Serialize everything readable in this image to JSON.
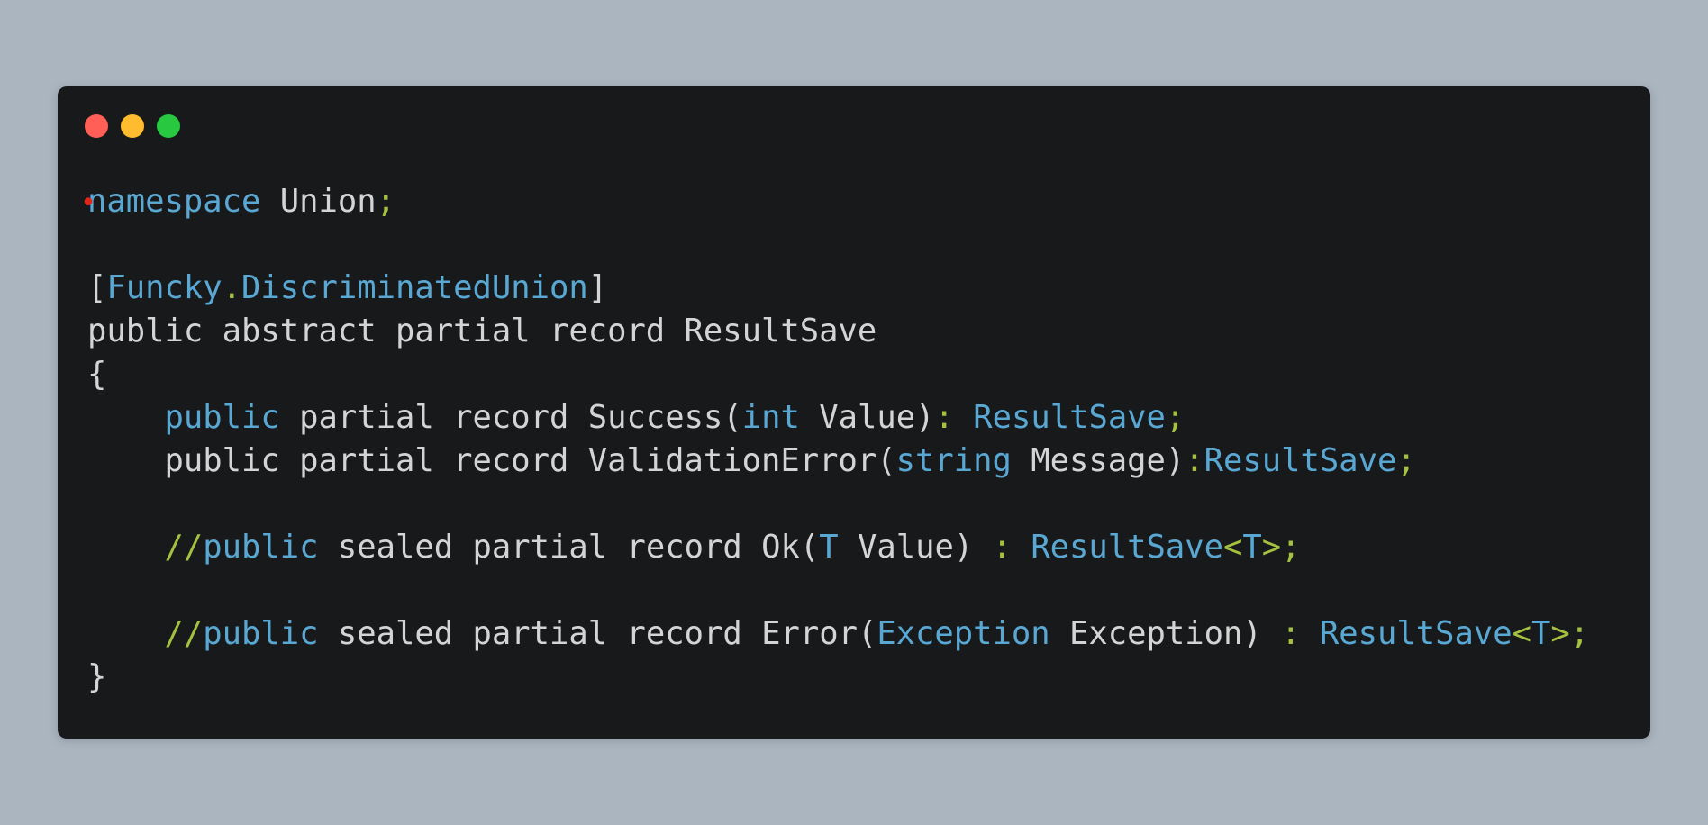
{
  "window": {
    "dots": [
      {
        "name": "close-dot",
        "color": "#ff5f57"
      },
      {
        "name": "minimize-dot",
        "color": "#febc2e"
      },
      {
        "name": "maximize-dot",
        "color": "#28c840"
      }
    ]
  },
  "colors": {
    "background": "#abb5c0",
    "editor": "#18191b",
    "text": "#d4d4d4",
    "keyword": "#59a7d3",
    "punctuation": "#a4c13f",
    "marker": "#e0261b"
  },
  "code_lines": [
    {
      "tokens": [
        {
          "t": "•",
          "c": "marker"
        },
        {
          "t": "namespace",
          "c": "keyword"
        },
        {
          "t": " Union",
          "c": "text"
        },
        {
          "t": ";",
          "c": "punctuation"
        }
      ]
    },
    {
      "tokens": []
    },
    {
      "tokens": [
        {
          "t": "[",
          "c": "text"
        },
        {
          "t": "Funcky",
          "c": "keyword"
        },
        {
          "t": ".",
          "c": "punctuation"
        },
        {
          "t": "DiscriminatedUnion",
          "c": "keyword"
        },
        {
          "t": "]",
          "c": "text"
        }
      ]
    },
    {
      "tokens": [
        {
          "t": "public abstract partial record ResultSave",
          "c": "text"
        }
      ]
    },
    {
      "tokens": [
        {
          "t": "{",
          "c": "text"
        }
      ]
    },
    {
      "tokens": [
        {
          "t": "    ",
          "c": "text"
        },
        {
          "t": "public",
          "c": "keyword"
        },
        {
          "t": " partial record Success(",
          "c": "text"
        },
        {
          "t": "int",
          "c": "keyword"
        },
        {
          "t": " Value)",
          "c": "text"
        },
        {
          "t": ": ",
          "c": "punctuation"
        },
        {
          "t": "ResultSave",
          "c": "keyword"
        },
        {
          "t": ";",
          "c": "punctuation"
        }
      ]
    },
    {
      "tokens": [
        {
          "t": "    public partial record ValidationError(",
          "c": "text"
        },
        {
          "t": "string",
          "c": "keyword"
        },
        {
          "t": " Message)",
          "c": "text"
        },
        {
          "t": ":",
          "c": "punctuation"
        },
        {
          "t": "ResultSave",
          "c": "keyword"
        },
        {
          "t": ";",
          "c": "punctuation"
        }
      ]
    },
    {
      "tokens": []
    },
    {
      "tokens": [
        {
          "t": "    ",
          "c": "text"
        },
        {
          "t": "//",
          "c": "punctuation"
        },
        {
          "t": "public",
          "c": "keyword"
        },
        {
          "t": " sealed partial record Ok(",
          "c": "text"
        },
        {
          "t": "T",
          "c": "keyword"
        },
        {
          "t": " Value) ",
          "c": "text"
        },
        {
          "t": ": ",
          "c": "punctuation"
        },
        {
          "t": "ResultSave",
          "c": "keyword"
        },
        {
          "t": "<",
          "c": "punctuation"
        },
        {
          "t": "T",
          "c": "keyword"
        },
        {
          "t": ">;",
          "c": "punctuation"
        }
      ]
    },
    {
      "tokens": []
    },
    {
      "tokens": [
        {
          "t": "    ",
          "c": "text"
        },
        {
          "t": "//",
          "c": "punctuation"
        },
        {
          "t": "public",
          "c": "keyword"
        },
        {
          "t": " sealed partial record Error(",
          "c": "text"
        },
        {
          "t": "Exception",
          "c": "keyword"
        },
        {
          "t": " Exception) ",
          "c": "text"
        },
        {
          "t": ": ",
          "c": "punctuation"
        },
        {
          "t": "ResultSave",
          "c": "keyword"
        },
        {
          "t": "<",
          "c": "punctuation"
        },
        {
          "t": "T",
          "c": "keyword"
        },
        {
          "t": ">;",
          "c": "punctuation"
        }
      ]
    },
    {
      "tokens": [
        {
          "t": "}",
          "c": "text"
        }
      ]
    }
  ]
}
